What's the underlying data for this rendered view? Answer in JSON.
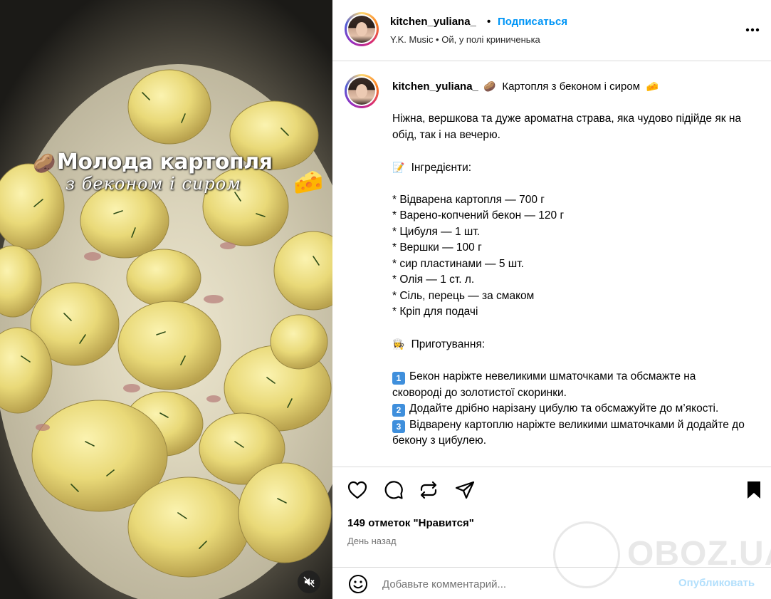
{
  "media": {
    "overlay_title": "Молода картопля",
    "overlay_subtitle": "з беконом і сиром",
    "potato_emoji": "🥔",
    "cheese_emoji": "🧀",
    "mute_icon": "speaker-muted-icon"
  },
  "header": {
    "username": "kitchen_yuliana_",
    "separator": "•",
    "follow_label": "Подписаться",
    "music": "Y.K. Music • Ой, у полі криниченька",
    "more_icon": "more-horizontal-icon"
  },
  "caption": {
    "username": "kitchen_yuliana_",
    "title_emoji": "🥔",
    "title": "Картопля з беконом і сиром",
    "title_emoji_end": "🧀",
    "intro": "Ніжна, вершкова та дуже ароматна страва, яка чудово підійде як на обід, так і на вечерю.",
    "ingredients_emoji": "📝",
    "ingredients_heading": "Інгредієнти:",
    "ingredients": [
      "* Відварена картопля — 700 г",
      "* Варено-копчений бекон — 120 г",
      "* Цибуля — 1 шт.",
      "* Вершки — 100 г",
      "* сир пластинами — 5 шт.",
      "* Олія — 1 ст. л.",
      "* Сіль, перець — за смаком",
      "* Кріп для подачі"
    ],
    "steps_emoji": "👩‍🍳",
    "steps_heading": "Приготування:",
    "steps": [
      {
        "num": "1",
        "text": "Бекон наріжте невеликими шматочками та обсмажте на сковороді до золотистої скоринки."
      },
      {
        "num": "2",
        "text": "Додайте дрібно нарізану цибулю та обсмажуйте до м’якості."
      },
      {
        "num": "3",
        "text": "Відварену картоплю наріжте великими шматочками й додайте до бекону з цибулею."
      }
    ]
  },
  "actions": {
    "like_icon": "heart-icon",
    "comment_icon": "comment-icon",
    "repost_icon": "repost-icon",
    "share_icon": "share-icon",
    "save_icon": "bookmark-icon",
    "likes": "149 отметок \"Нравится\"",
    "time": "День назад"
  },
  "comment": {
    "emoji_icon": "smiley-icon",
    "placeholder": "Добавьте комментарий...",
    "publish_label": "Опубликовать"
  },
  "watermark": {
    "text": "OBOZ.UA"
  },
  "colors": {
    "accent": "#0095f6",
    "publish_disabled": "#b2dffc",
    "border": "#dbdbdb",
    "muted_text": "#737373"
  }
}
